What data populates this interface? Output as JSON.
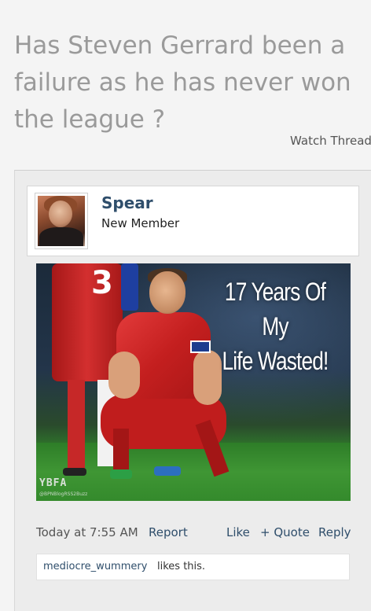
{
  "thread": {
    "title": "Has Steven Gerrard been a failure as he has never won the league ?",
    "watch_label": "Watch Thread"
  },
  "post": {
    "author": {
      "username": "Spear",
      "user_title": "New Member"
    },
    "image": {
      "caption_line1": "17 Years Of My",
      "caption_line2": "Life Wasted!",
      "jersey_number": "3",
      "watermark": "YBFA",
      "watermark_sub": "@BPNBlogRSS2Buzz"
    },
    "timestamp": "Today at 7:55 AM",
    "actions": {
      "report": "Report",
      "like": "Like",
      "quote": "+ Quote",
      "reply": "Reply"
    },
    "likes": {
      "liker": "mediocre_wummery",
      "suffix": "likes this."
    }
  },
  "colors": {
    "background": "#f4f4f4",
    "title_gray": "#9a9a9a",
    "link_blue": "#2f4e6b"
  }
}
